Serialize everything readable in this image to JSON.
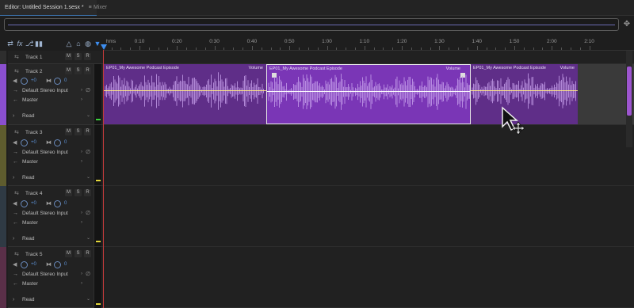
{
  "tabs": {
    "editor_label": "Editor: Untitled Session 1.sesx *",
    "editor_menu": "≡",
    "mixer_label": "Mixer"
  },
  "toolbar_icons": [
    "swap-icon",
    "fx-icon",
    "send-icon",
    "bars-icon",
    "metronome-icon",
    "lock-icon",
    "monitor-icon",
    "playhead-icon"
  ],
  "timeline": {
    "unit_label": "hms",
    "ticks": [
      "0:10",
      "0:20",
      "0:30",
      "0:40",
      "0:50",
      "1:00",
      "1:10",
      "1:20",
      "1:30",
      "1:40",
      "1:50",
      "2:00",
      "2:10"
    ]
  },
  "tracks": [
    {
      "name": "Track 1",
      "collapsed": true,
      "color": "#3a3a3a"
    },
    {
      "name": "Track 2",
      "collapsed": false,
      "color": "#8a4fcf",
      "volume": "+0",
      "pan": "0",
      "input": "Default Stereo Input",
      "output": "Master",
      "automation": "Read"
    },
    {
      "name": "Track 3",
      "collapsed": false,
      "color": "#6e6c35",
      "volume": "+0",
      "pan": "0",
      "input": "Default Stereo Input",
      "output": "Master",
      "automation": "Read"
    },
    {
      "name": "Track 4",
      "collapsed": false,
      "color": "#3a4a5a",
      "volume": "+0",
      "pan": "0",
      "input": "Default Stereo Input",
      "output": "Master",
      "automation": "Read"
    },
    {
      "name": "Track 5",
      "collapsed": false,
      "color": "#6a3a55",
      "volume": "+0",
      "pan": "0",
      "input": "Default Stereo Input",
      "output": "Master",
      "automation": "Read"
    }
  ],
  "buttons": {
    "mute": "M",
    "solo": "S",
    "record": "R"
  },
  "clips": [
    {
      "title": "EP01_My Awesome Podcast Episode",
      "volume_label": "Volume",
      "selected": false
    },
    {
      "title": "EP01_My Awesome Podcast Episode",
      "volume_label": "Volume",
      "selected": true
    },
    {
      "title": "EP01_My Awesome Podcast Episode",
      "volume_label": "Volume",
      "selected": false
    }
  ],
  "colors": {
    "clip": "#6a2f9c",
    "clip_selected": "#7b38b8",
    "waveform": "#c9a3ee",
    "playhead": "#3d8ef0",
    "meter_peak": "#e3d63a"
  }
}
